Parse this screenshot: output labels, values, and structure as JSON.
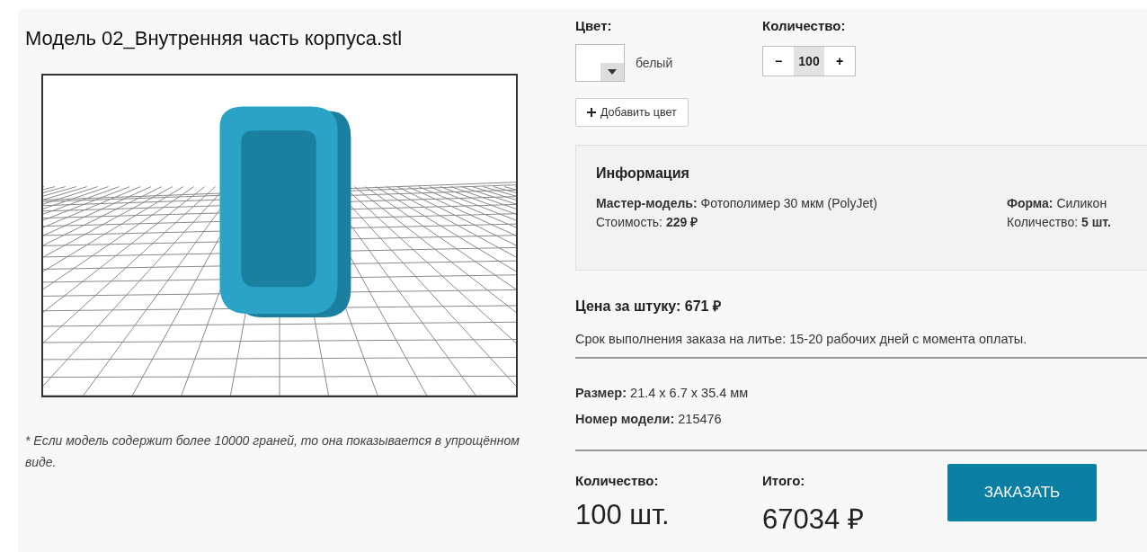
{
  "title": "Модель 02_Внутренняя часть корпуса.stl",
  "note": "* Если модель содержит более 10000 граней, то она показывается в упрощённом виде.",
  "color": {
    "label": "Цвет:",
    "value": "белый",
    "add_button": "Добавить цвет"
  },
  "quantity": {
    "label": "Количество:",
    "minus": "−",
    "value": "100",
    "plus": "+"
  },
  "info": {
    "title": "Информация",
    "columns": [
      [
        "**Мастер-модель:** Фотополимер 30 мкм (PolyJet)",
        "Стоимость: **229 ₽**"
      ],
      [
        "**Форма:** Силикон",
        "Количество: **5 шт.**"
      ]
    ]
  },
  "unit_price": "Цена за штуку: 671 ₽",
  "lead_time": "Срок выполнения заказа на литье: 15-20 рабочих дней с момента оплаты.",
  "specs": [
    "**Размер:** 21.4 x 6.7 x 35.4 мм",
    "**Номер модели:** 215476"
  ],
  "summary": {
    "quantity_label": "Количество:",
    "quantity": "100 шт.",
    "total_label": "Итого:",
    "total": "67034 ₽",
    "order_button": "ЗАКАЗАТЬ"
  }
}
